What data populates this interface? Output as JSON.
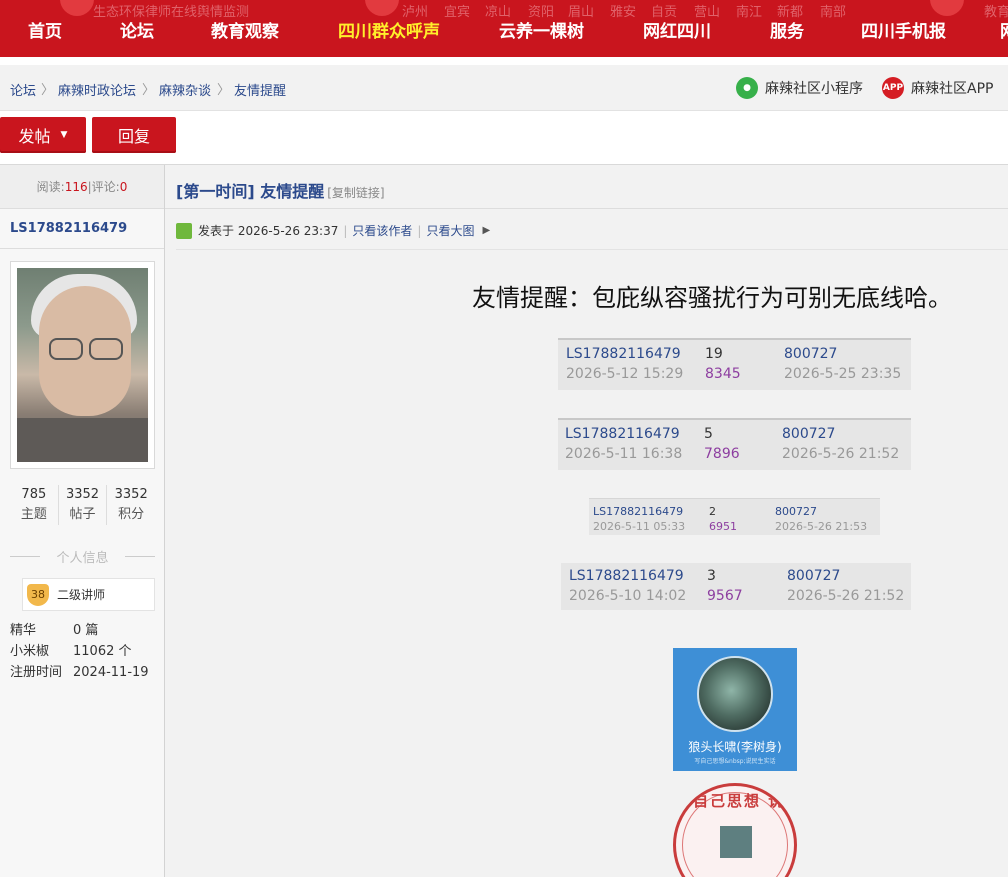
{
  "topnav": {
    "ticker": [
      "生态环保律师在线舆情监测",
      "泸州",
      "宜宾",
      "凉山",
      "资阳",
      "眉山",
      "雅安",
      "自贡",
      "营山",
      "南江",
      "新都",
      "南部",
      "教育"
    ],
    "items": [
      "首页",
      "论坛",
      "教育观察",
      "四川群众呼声",
      "云养一棵树",
      "网红四川",
      "服务",
      "四川手机报",
      "网"
    ]
  },
  "breadcrumb": [
    "论坛",
    "麻辣时政论坛",
    "麻辣杂谈",
    "友情提醒"
  ],
  "breadcrumb_sep": "〉",
  "header_links": {
    "mini_program": "麻辣社区小程序",
    "app": "麻辣社区APP",
    "app_badge": "APP"
  },
  "actions": {
    "post": "发帖",
    "reply": "回复"
  },
  "thread_stats": {
    "views_label": "阅读:",
    "views": "116",
    "sep": "|",
    "comments_label": "评论:",
    "comments": "0"
  },
  "author": {
    "name": "LS17882116479",
    "stats": [
      {
        "value": "785",
        "label": "主题"
      },
      {
        "value": "3352",
        "label": "帖子"
      },
      {
        "value": "3352",
        "label": "积分"
      }
    ],
    "profile_heading": "个人信息",
    "rank_level": "38",
    "rank_title": "二级讲师",
    "fields": [
      {
        "key": "精华",
        "value": "0 篇"
      },
      {
        "key": "小米椒",
        "value": "11062 个"
      },
      {
        "key": "注册时间",
        "value": "2024-11-19"
      }
    ]
  },
  "post": {
    "title": "[第一时间] 友情提醒",
    "copy_link": "[复制链接]",
    "posted_label": "发表于",
    "posted_at": "2026-5-26 23:37",
    "only_author": "只看该作者",
    "only_big_image": "只看大图",
    "sep": "|",
    "message": "友情提醒：包庇纵容骚扰行为可别无底线哈。",
    "cards": [
      {
        "user": "LS17882116479",
        "date": "2026-5-12 15:29",
        "replies": "19",
        "views": "8345",
        "last_user": "800727",
        "last_date": "2026-5-25 23:35"
      },
      {
        "user": "LS17882116479",
        "date": "2026-5-11 16:38",
        "replies": "5",
        "views": "7896",
        "last_user": "800727",
        "last_date": "2026-5-26 21:52"
      },
      {
        "user": "LS17882116479",
        "date": "2026-5-11 05:33",
        "replies": "2",
        "views": "6951",
        "last_user": "800727",
        "last_date": "2026-5-26 21:53"
      },
      {
        "user": "LS17882116479",
        "date": "2026-5-10 14:02",
        "replies": "3",
        "views": "9567",
        "last_user": "800727",
        "last_date": "2026-5-26 21:52"
      }
    ],
    "signature_name": "狼头长啸(李树身)",
    "signature_sub": "写自己思想&nbsp;说民生实话",
    "seal_text": "写自己思想 说民生实话"
  },
  "colors": {
    "brand_red": "#c9151e",
    "link_blue": "#2c4a8c",
    "active_nav": "#ffee2b",
    "views_purple": "#8d3ea0"
  }
}
